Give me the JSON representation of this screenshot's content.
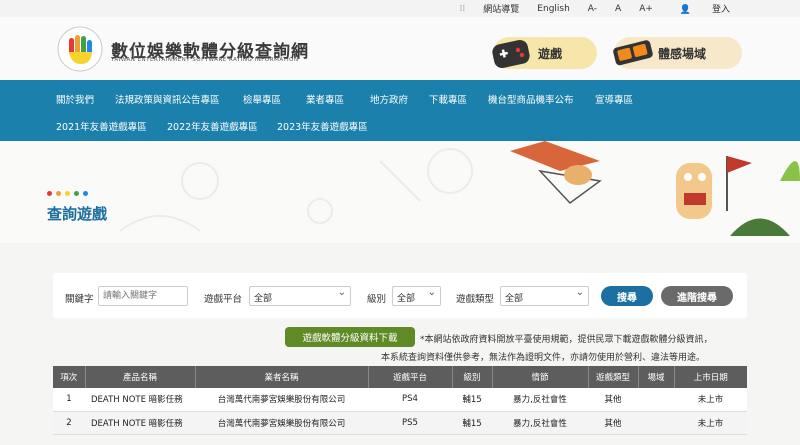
{
  "topbar": {
    "icon": "grid-dots-icon",
    "sitemap": "網站導覽",
    "english": "English",
    "font_small": "A-",
    "font_normal": "A",
    "font_large": "A+",
    "login": "登入"
  },
  "header": {
    "title": "數位娛樂軟體分級查詢網",
    "subtitle": "TAIWAN ENTERTAINMENT SOFTWARE RATING INFORMATION",
    "games_label": "遊戲",
    "venue_label": "體感場域"
  },
  "nav": {
    "row1": [
      "關於我們",
      "法規政策與資訊公告專區",
      "檢舉專區",
      "業者專區",
      "地方政府",
      "下載專區",
      "機台型商品機率公布",
      "宣導專區"
    ],
    "row2": [
      "2021年友善遊戲專區",
      "2022年友善遊戲專區",
      "2023年友善遊戲專區"
    ]
  },
  "page": {
    "title": "查詢遊戲"
  },
  "colors": {
    "nav": "#1c80ac",
    "accent": "#1c6fa1",
    "download": "#5f8a26",
    "header_row": "#5d5d5d",
    "dots": [
      "#e53935",
      "#f0a030",
      "#f6d32d",
      "#43a047",
      "#1e88e5"
    ]
  },
  "search": {
    "keyword_label": "關鍵字",
    "keyword_placeholder": "請輸入關鍵字",
    "platform_label": "遊戲平台",
    "platform_value": "全部",
    "rating_label": "級別",
    "rating_value": "全部",
    "type_label": "遊戲類型",
    "type_value": "全部",
    "search_button": "搜尋",
    "advanced_button": "進階搜尋"
  },
  "download": {
    "button": "遊戲軟體分級資料下載",
    "note1": "*本網站依政府資料開放平臺使用規範，提供民眾下載遊戲軟體分級資訊，",
    "note2": "本系統查詢資料僅供參考，無法作為證明文件，亦請勿使用於營利、違法等用途。"
  },
  "table": {
    "headers": [
      "項次",
      "產品名稱",
      "業者名稱",
      "遊戲平台",
      "級別",
      "情節",
      "遊戲類型",
      "場域",
      "上市日期"
    ],
    "rows": [
      [
        "1",
        "DEATH NOTE 暗影任務",
        "台灣萬代南夢宮娛樂股份有限公司",
        "PS4",
        "輔15",
        "暴力,反社會性",
        "其他",
        "",
        "未上市"
      ],
      [
        "2",
        "DEATH NOTE 暗影任務",
        "台灣萬代南夢宮娛樂股份有限公司",
        "PS5",
        "輔15",
        "暴力,反社會性",
        "其他",
        "",
        "未上市"
      ]
    ]
  }
}
